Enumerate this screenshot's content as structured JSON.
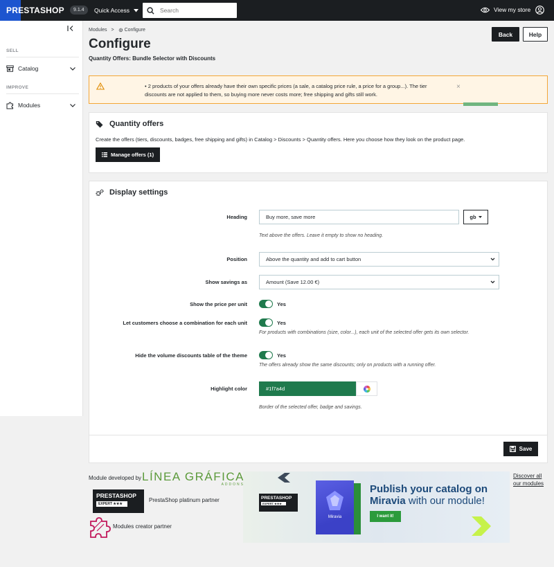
{
  "topbar": {
    "logo": "PRESTASHOP",
    "version": "9.1.4",
    "quick_access": "Quick Access",
    "search_placeholder": "Search",
    "view_store": "View my store"
  },
  "sidebar": {
    "sections": [
      {
        "title": "SELL",
        "items": [
          {
            "label": "Catalog",
            "icon": "storefront-icon"
          }
        ]
      },
      {
        "title": "IMPROVE",
        "items": [
          {
            "label": "Modules",
            "icon": "puzzle-icon"
          }
        ]
      }
    ]
  },
  "breadcrumb": {
    "parent": "Modules",
    "separator": ">",
    "current": "Configure"
  },
  "header": {
    "title": "Configure",
    "subtitle": "Quantity Offers: Bundle Selector with Discounts",
    "back_label": "Back",
    "help_label": "Help"
  },
  "alert": {
    "message": "2 products of your offers already have their own specific prices (a sale, a catalog price rule, a price for a group...). The tier discounts are not applied to them, so buying more never costs more; free shipping and gifts still work.",
    "close": "×"
  },
  "quantity_panel": {
    "title": "Quantity offers",
    "description": "Create the offers (tiers, discounts, badges, free shipping and gifts) in Catalog > Discounts > Quantity offers. Here you choose how they look on the product page.",
    "manage_button": "Manage offers (1)"
  },
  "display_panel": {
    "title": "Display settings",
    "heading": {
      "label": "Heading",
      "value": "Buy more, save more",
      "lang": "gb",
      "help": "Text above the offers. Leave it empty to show no heading."
    },
    "position": {
      "label": "Position",
      "value": "Above the quantity and add to cart button"
    },
    "savings": {
      "label": "Show savings as",
      "value": "Amount (Save 12.00 €)"
    },
    "price_per_unit": {
      "label": "Show the price per unit",
      "value": "Yes"
    },
    "combination": {
      "label": "Let customers choose a combination for each unit",
      "value": "Yes",
      "help": "For products with combinations (size, color...), each unit of the selected offer gets its own selector."
    },
    "hide_table": {
      "label": "Hide the volume discounts table of the theme",
      "value": "Yes",
      "help": "The offers already show the same discounts; only on products with a running offer."
    },
    "highlight": {
      "label": "Highlight color",
      "value": "#1f7a4d",
      "help": "Border of the selected offer, badge and savings."
    },
    "save_label": "Save"
  },
  "footer": {
    "developed_by": "Module developed by",
    "lg_logo": "LÍNEA GRÁFICA",
    "lg_sub": "ADDONS",
    "badge_title": "PRESTASHOP",
    "badge_sub": "EXPERT ★★★",
    "partner1": "PrestaShop platinum partner",
    "partner2": "Modules creator partner",
    "banner": {
      "title_line1": "Publish your catalog on",
      "title_line2_bold": "Miravia",
      "title_line2_light": " with our module!",
      "button": "I want it!",
      "box_brand": "Miravia"
    },
    "discover": "Discover all our modules"
  },
  "colors": {
    "accent": "#1f7a4d",
    "topbar": "#1b1e21",
    "logo_blue": "#1d55cf",
    "alert_border": "#f4a636"
  }
}
